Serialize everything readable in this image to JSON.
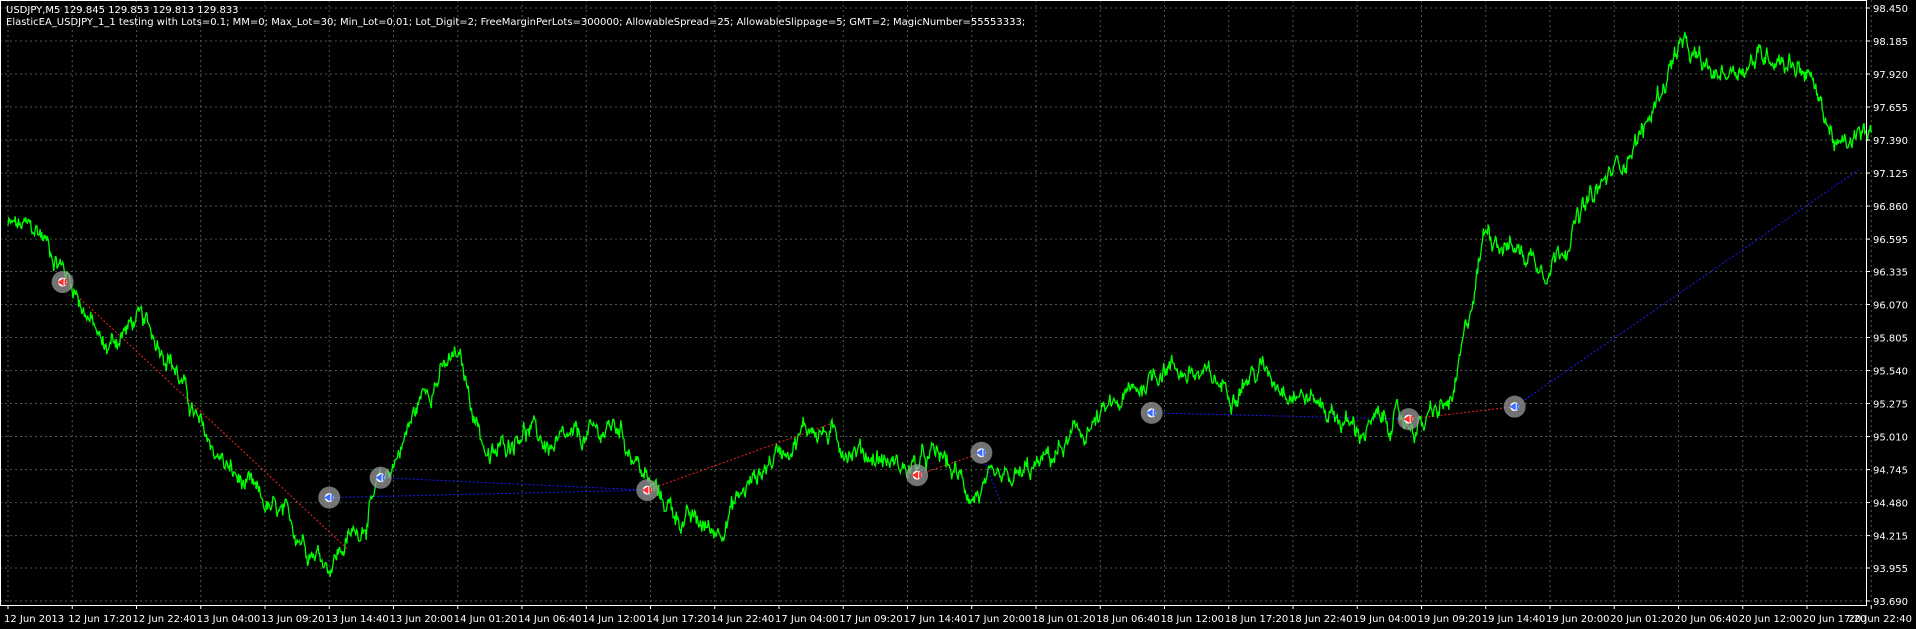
{
  "header": {
    "symbol_line": "USDJPY,M5  129.845 129.853 129.813 129.833",
    "ea_line": "ElasticEA_USDJPY_1_1 testing with Lots=0.1; MM=0; Max_Lot=30; Min_Lot=0.01; Lot_Digit=2; FreeMarginPerLots=300000; AllowableSpread=25; AllowableSlippage=5; GMT=2; MagicNumber=55553333;"
  },
  "colors": {
    "background": "#000000",
    "grid": "#4a5a4a",
    "axis": "#ffffff",
    "price": "#00ff00",
    "buy_trade_line": "#1a1aff",
    "sell_trade_line": "#ff2020",
    "marker_ring": "#9a9a9a",
    "buy_marker": "#3b6bff",
    "sell_marker": "#ff3030"
  },
  "chart_data": {
    "type": "line",
    "title": "",
    "xlabel": "",
    "ylabel": "",
    "ylim": [
      93.69,
      98.45
    ],
    "y_ticks": [
      "98.450",
      "98.185",
      "97.920",
      "97.655",
      "97.390",
      "97.125",
      "96.860",
      "96.595",
      "96.335",
      "96.070",
      "95.805",
      "95.540",
      "95.275",
      "95.010",
      "94.745",
      "94.480",
      "94.215",
      "93.955",
      "93.690"
    ],
    "x_ticks": [
      "12 Jun 2013",
      "12 Jun 17:20",
      "12 Jun 22:40",
      "13 Jun 04:00",
      "13 Jun 09:20",
      "13 Jun 14:40",
      "13 Jun 20:00",
      "14 Jun 01:20",
      "14 Jun 06:40",
      "14 Jun 12:00",
      "14 Jun 17:20",
      "14 Jun 22:40",
      "17 Jun 04:00",
      "17 Jun 09:20",
      "17 Jun 14:40",
      "17 Jun 20:00",
      "18 Jun 01:20",
      "18 Jun 06:40",
      "18 Jun 12:00",
      "18 Jun 17:20",
      "18 Jun 22:40",
      "19 Jun 04:00",
      "19 Jun 09:20",
      "19 Jun 14:40",
      "19 Jun 20:00",
      "20 Jun 01:20",
      "20 Jun 06:40",
      "20 Jun 12:00",
      "20 Jun 17:20",
      "20 Jun 22:40"
    ],
    "grid": true,
    "series": [
      {
        "x": [
          0,
          0.5,
          1,
          1.5,
          2,
          2.5,
          3,
          3.5,
          4,
          4.5,
          5,
          5.5,
          6,
          6.5,
          7,
          7.5,
          8,
          8.5,
          9,
          9.5,
          10,
          10.5,
          11,
          11.5,
          12,
          12.5,
          13,
          13.5,
          14,
          14.5,
          15,
          15.5,
          16,
          16.5,
          17,
          17.5,
          18,
          18.5,
          19,
          19.5,
          20,
          20.5,
          21,
          21.5,
          22,
          22.5,
          23,
          23.5,
          24,
          24.5,
          25,
          25.5,
          26,
          26.5,
          27,
          27.5,
          28,
          28.5,
          29
        ],
        "values": [
          96.7,
          96.65,
          96.25,
          95.7,
          95.95,
          95.7,
          95.05,
          94.7,
          94.45,
          94.25,
          94.0,
          94.3,
          94.8,
          95.4,
          95.65,
          94.8,
          95.1,
          94.9,
          95.0,
          95.1,
          94.6,
          94.35,
          94.25,
          94.6,
          94.9,
          95.1,
          94.95,
          94.85,
          94.75,
          94.85,
          94.55,
          94.6,
          94.75,
          94.95,
          95.15,
          95.35,
          95.6,
          95.5,
          95.4,
          95.55,
          95.4,
          95.25,
          95.05,
          95.15,
          95.1,
          95.3,
          96.7,
          96.5,
          96.4,
          96.8,
          97.15,
          97.5,
          98.15,
          97.9,
          98.0,
          98.1,
          97.95,
          97.3,
          97.45
        ]
      }
    ],
    "trades": [
      {
        "side": "sell",
        "open_x": 0.85,
        "open_y": 96.25,
        "close_x": 5.3,
        "close_y": 94.1
      },
      {
        "side": "buy",
        "open_x": 5.0,
        "open_y": 94.52,
        "close_x": 9.95,
        "close_y": 94.58
      },
      {
        "side": "buy",
        "open_x": 5.8,
        "open_y": 94.68,
        "close_x": 9.95,
        "close_y": 94.58
      },
      {
        "side": "sell",
        "open_x": 9.95,
        "open_y": 94.58,
        "close_x": 12.85,
        "close_y": 95.12
      },
      {
        "side": "sell",
        "open_x": 14.15,
        "open_y": 94.7,
        "close_x": 15.15,
        "close_y": 94.88
      },
      {
        "side": "buy",
        "open_x": 15.15,
        "open_y": 94.88,
        "close_x": 15.45,
        "close_y": 94.48
      },
      {
        "side": "buy",
        "open_x": 17.8,
        "open_y": 95.2,
        "close_x": 21.8,
        "close_y": 95.15
      },
      {
        "side": "sell",
        "open_x": 21.8,
        "open_y": 95.15,
        "close_x": 23.45,
        "close_y": 95.25
      },
      {
        "side": "buy",
        "open_x": 23.45,
        "open_y": 95.25,
        "close_x": 28.8,
        "close_y": 97.15
      }
    ]
  }
}
